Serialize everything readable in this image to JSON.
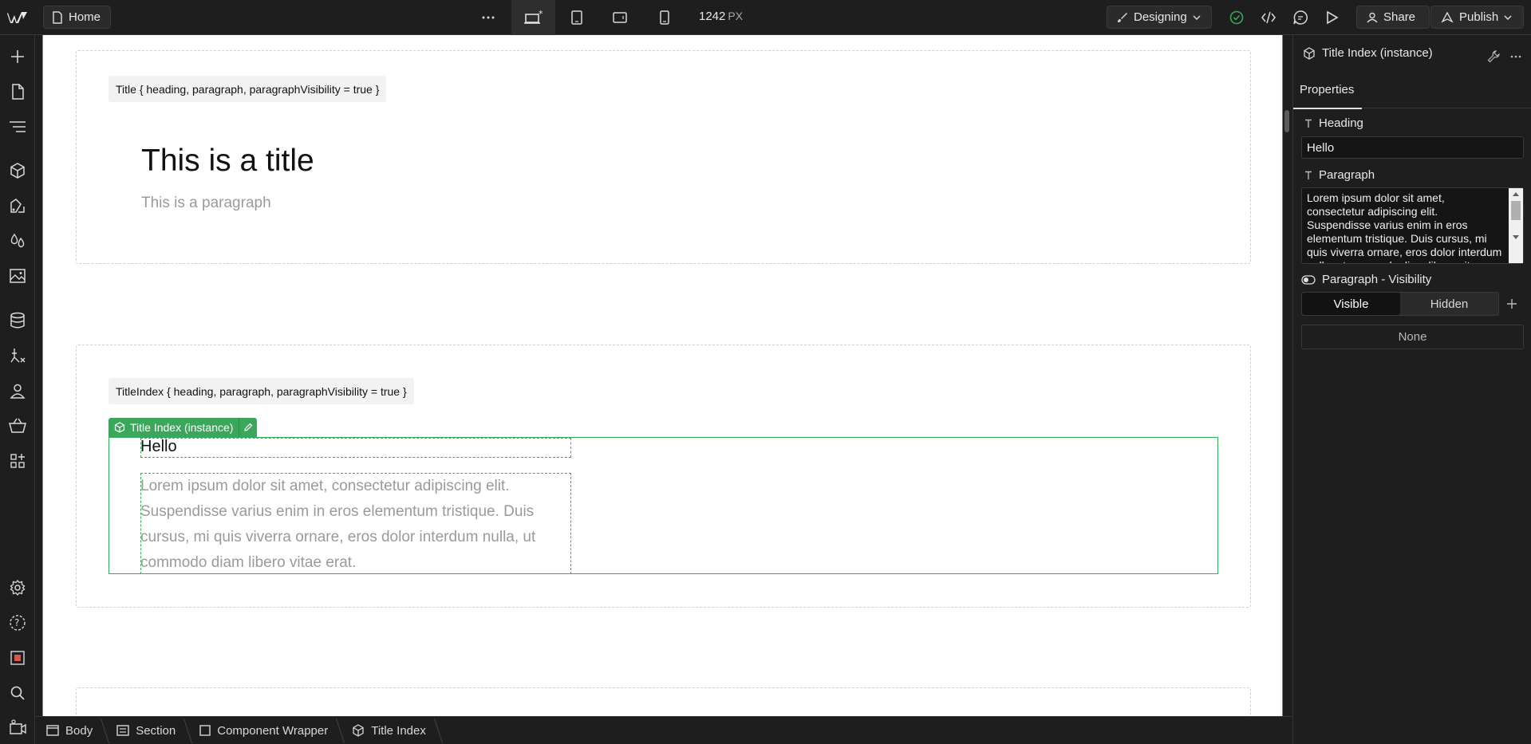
{
  "topbar": {
    "home_label": "Home",
    "more_icon": "more-dots-icon",
    "canvas_width": "1242",
    "canvas_unit": "PX",
    "mode_label": "Designing",
    "share_label": "Share",
    "publish_label": "Publish"
  },
  "canvas": {
    "section1": {
      "code_chip": "Title { heading, paragraph, paragraphVisibility = true }",
      "title": "This is a title",
      "paragraph": "This is a paragraph"
    },
    "section2": {
      "code_chip": "TitleIndex { heading, paragraph, paragraphVisibility = true }",
      "instance_tag": "Title Index (instance)",
      "heading": "Hello",
      "paragraph": "Lorem ipsum dolor sit amet, consectetur adipiscing elit. Suspendisse varius enim in eros elementum tristique. Duis cursus, mi quis viverra ornare, eros dolor interdum nulla, ut commodo diam libero vitae erat."
    }
  },
  "breadcrumb": [
    {
      "label": "Body",
      "icon": "body-icon"
    },
    {
      "label": "Section",
      "icon": "section-icon"
    },
    {
      "label": "Component Wrapper",
      "icon": "div-block-icon"
    },
    {
      "label": "Title Index",
      "icon": "component-icon"
    }
  ],
  "rightpanel": {
    "title": "Title Index (instance)",
    "tab": "Properties",
    "heading_label": "Heading",
    "heading_value": "Hello",
    "paragraph_label": "Paragraph",
    "paragraph_value": "Lorem ipsum dolor sit amet, consectetur adipiscing elit. Suspendisse varius enim in eros elementum tristique. Duis cursus, mi quis viverra ornare, eros dolor interdum nulla, ut commodo diam libero vitae erat.",
    "visibility_label": "Paragraph - Visibility",
    "visible_option": "Visible",
    "hidden_option": "Hidden",
    "none_label": "None"
  },
  "colors": {
    "accent_green": "#3aa75a",
    "canvas_border": "#4a90d9",
    "panel_bg": "#1e1e1e"
  }
}
